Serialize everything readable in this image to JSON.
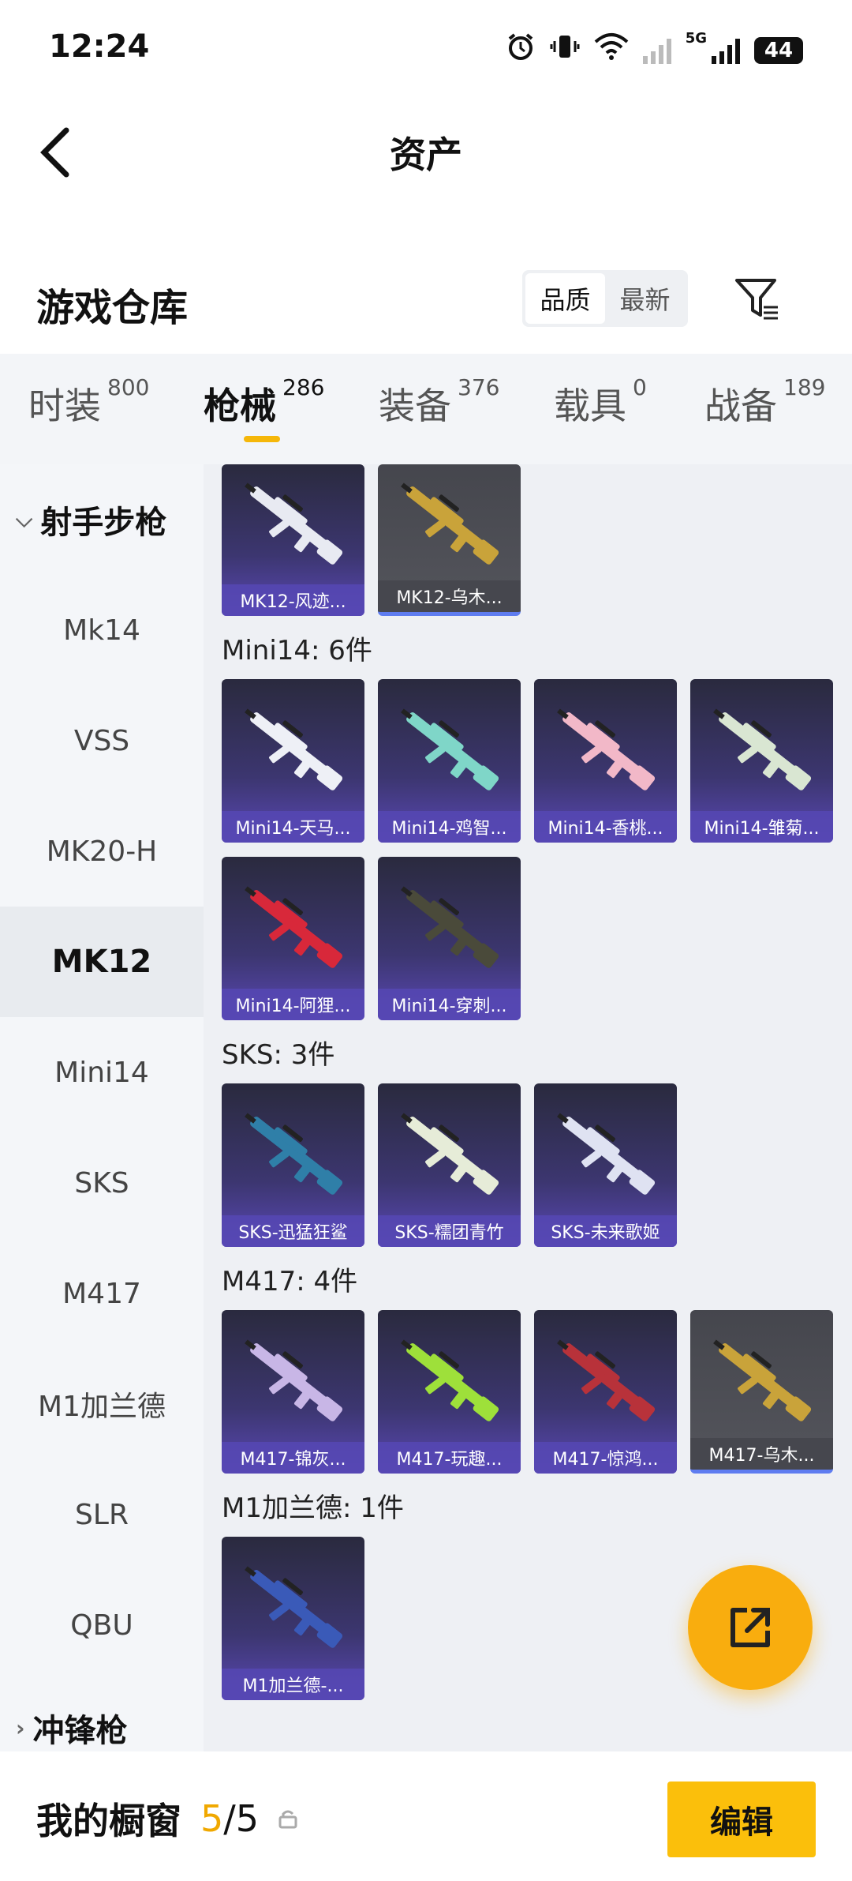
{
  "status_bar": {
    "time": "12:24",
    "network": "5G",
    "battery": "44"
  },
  "nav": {
    "title": "资产"
  },
  "warehouse": {
    "title": "游戏仓库",
    "sort_options": [
      {
        "label": "品质",
        "active": true
      },
      {
        "label": "最新",
        "active": false
      }
    ]
  },
  "tabs": [
    {
      "label": "时装",
      "count": "800",
      "active": false
    },
    {
      "label": "枪械",
      "count": "286",
      "active": true
    },
    {
      "label": "装备",
      "count": "376",
      "active": false
    },
    {
      "label": "载具",
      "count": "0",
      "active": false
    },
    {
      "label": "战备",
      "count": "189",
      "active": false
    }
  ],
  "sidebar": {
    "group_open": "射手步枪",
    "items": [
      "Mk14",
      "VSS",
      "MK20-H",
      "MK12",
      "Mini14",
      "SKS",
      "M417",
      "M1加兰德",
      "SLR",
      "QBU"
    ],
    "active_item": "MK12",
    "group_closed": "冲锋枪"
  },
  "sections": [
    {
      "title": "",
      "cards": [
        {
          "name": "MK12-风迹...",
          "rarity": "purple",
          "gun_color": "#e8eaf2"
        },
        {
          "name": "MK12-乌木...",
          "rarity": "grey",
          "gun_color": "#c9a33a"
        }
      ]
    },
    {
      "title": "Mini14: 6件",
      "cards": [
        {
          "name": "Mini14-天马...",
          "rarity": "purple",
          "gun_color": "#eef0f6"
        },
        {
          "name": "Mini14-鸡智...",
          "rarity": "purple",
          "gun_color": "#7fd6c8"
        },
        {
          "name": "Mini14-香桃...",
          "rarity": "purple",
          "gun_color": "#f2b8c8"
        },
        {
          "name": "Mini14-雏菊...",
          "rarity": "purple",
          "gun_color": "#d9e6d2"
        },
        {
          "name": "Mini14-阿狸...",
          "rarity": "purple",
          "gun_color": "#d8283a"
        },
        {
          "name": "Mini14-穿刺...",
          "rarity": "purple",
          "gun_color": "#4a4a3a"
        }
      ]
    },
    {
      "title": "SKS: 3件",
      "cards": [
        {
          "name": "SKS-迅猛狂鲨",
          "rarity": "purple",
          "gun_color": "#2f7fa8"
        },
        {
          "name": "SKS-糯团青竹",
          "rarity": "purple",
          "gun_color": "#e6ecd8"
        },
        {
          "name": "SKS-未来歌姬",
          "rarity": "purple",
          "gun_color": "#dfe2f2"
        }
      ]
    },
    {
      "title": "M417: 4件",
      "cards": [
        {
          "name": "M417-锦灰...",
          "rarity": "purple",
          "gun_color": "#c8b6e6"
        },
        {
          "name": "M417-玩趣...",
          "rarity": "purple",
          "gun_color": "#9ee03a"
        },
        {
          "name": "M417-惊鸿...",
          "rarity": "purple",
          "gun_color": "#b8323a"
        },
        {
          "name": "M417-乌木...",
          "rarity": "grey",
          "gun_color": "#c9a33a"
        }
      ]
    },
    {
      "title": "M1加兰德: 1件",
      "cards": [
        {
          "name": "M1加兰德-...",
          "rarity": "purple",
          "gun_color": "#3a5ab8"
        }
      ]
    }
  ],
  "bottom": {
    "label": "我的橱窗",
    "used": "5",
    "sep": "/",
    "total": "5",
    "edit_label": "编辑"
  },
  "colors": {
    "accent": "#fbbf0b",
    "fab": "#f9ad0e",
    "card_purple": "#5a48b5"
  }
}
